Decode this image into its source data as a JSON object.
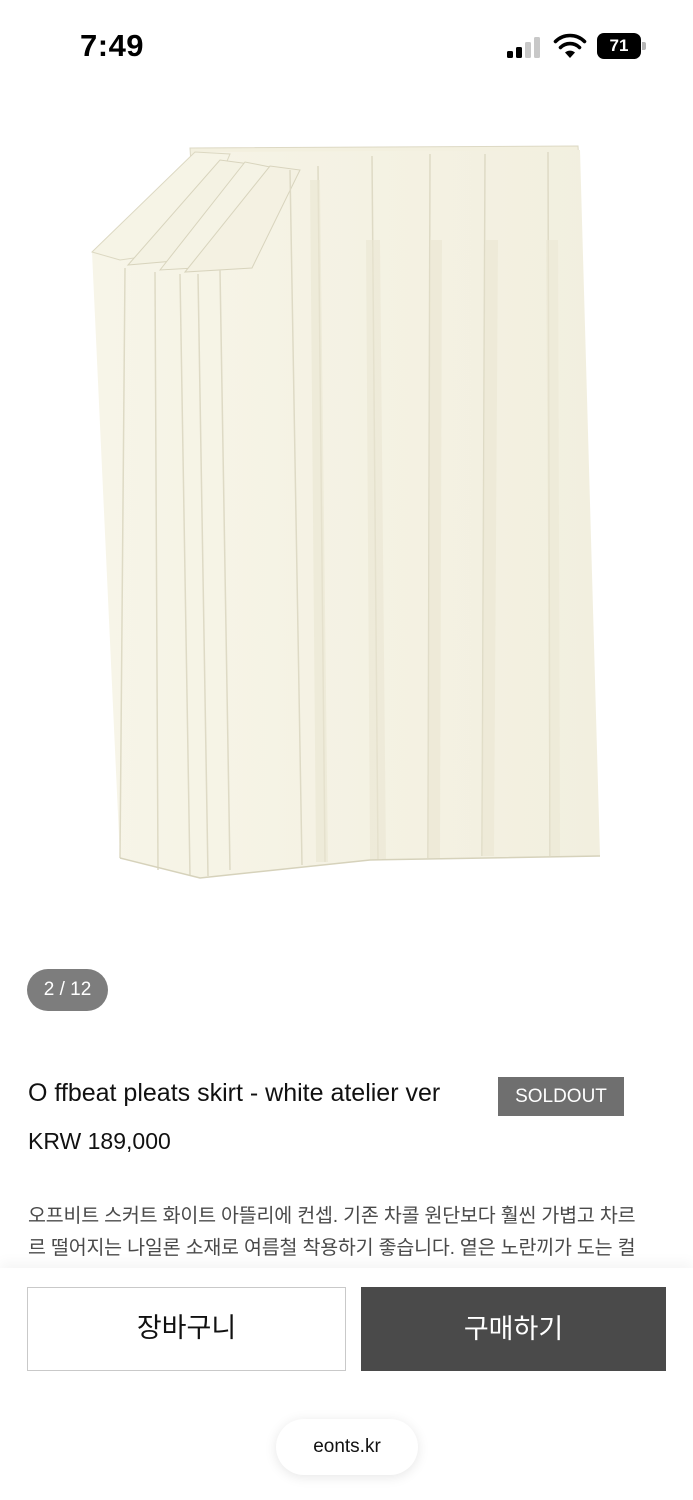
{
  "status_bar": {
    "time": "7:49",
    "battery_level": "71"
  },
  "gallery": {
    "counter": "2 / 12"
  },
  "product": {
    "title": "O ffbeat pleats skirt - white atelier ver",
    "badge": "SOLDOUT",
    "price": "KRW 189,000",
    "description_lines": [
      "오프비트 스커트 화이트 아뜰리에 컨셉. 기존 차콜 원단보다 훨씬 가볍고 차르",
      "르 떨어지는 나일론 소재로 여름철 착용하기 좋습니다. 옅은 노란끼가 도는 컬"
    ]
  },
  "actions": {
    "cart_label": "장바구니",
    "buy_label": "구매하기"
  },
  "browser": {
    "url": "eonts.kr"
  },
  "colors": {
    "badge_bg": "#6f6f6f",
    "buy_button_bg": "#4a4a4a",
    "fabric": "#f4f1e2"
  }
}
